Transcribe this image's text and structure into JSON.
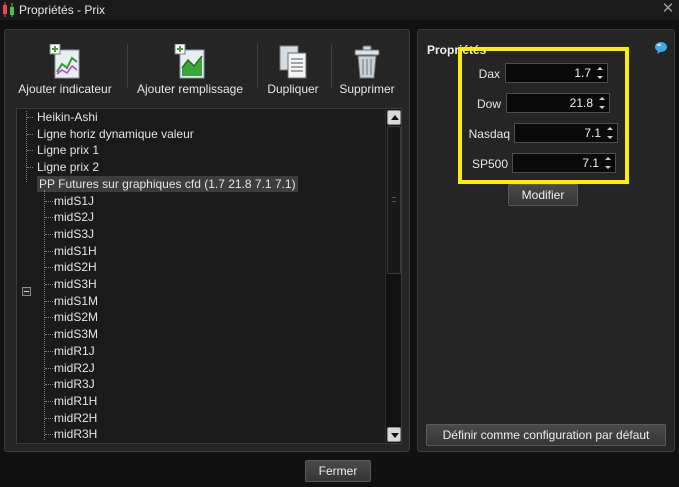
{
  "window": {
    "title": "Propriétés - Prix"
  },
  "toolbar": {
    "add_indicator_label": "Ajouter indicateur",
    "add_fill_label": "Ajouter remplissage",
    "duplicate_label": "Dupliquer",
    "delete_label": "Supprimer"
  },
  "tree": {
    "items": [
      "Heikin-Ashi",
      "Ligne horiz dynamique valeur",
      "Ligne prix 1",
      "Ligne prix 2",
      "PP Futures sur graphiques cfd (1.7 21.8 7.1 7.1)"
    ],
    "children": [
      "midS1J",
      "midS2J",
      "midS3J",
      "midS1H",
      "midS2H",
      "midS3H",
      "midS1M",
      "midS2M",
      "midS3M",
      "midR1J",
      "midR2J",
      "midR3J",
      "midR1H",
      "midR2H",
      "midR3H"
    ]
  },
  "properties": {
    "title": "Propriétés",
    "fields": [
      {
        "label": "Dax",
        "value": "1.7"
      },
      {
        "label": "Dow",
        "value": "21.8"
      },
      {
        "label": "Nasdaq",
        "value": "7.1"
      },
      {
        "label": "SP500",
        "value": "7.1"
      }
    ],
    "modify_label": "Modifier",
    "default_config_label": "Définir comme configuration par défaut"
  },
  "footer": {
    "close_label": "Fermer"
  },
  "colors": {
    "highlight": "#ffee00",
    "background": "#111111",
    "panel": "#252525"
  }
}
